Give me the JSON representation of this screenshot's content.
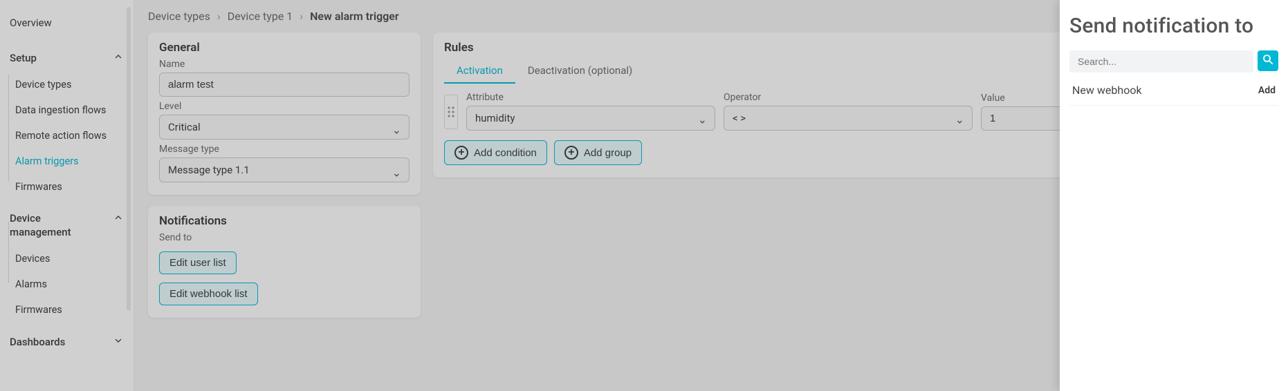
{
  "sidebar": {
    "overview": "Overview",
    "setup": "Setup",
    "device_types": "Device types",
    "data_ingestion": "Data ingestion flows",
    "remote_action": "Remote action flows",
    "alarm_triggers": "Alarm triggers",
    "firmwares": "Firmwares",
    "device_management": "Device management",
    "devices": "Devices",
    "alarms": "Alarms",
    "firmwares2": "Firmwares",
    "dashboards": "Dashboards"
  },
  "breadcrumb": {
    "a": "Device types",
    "b": "Device type 1",
    "c": "New alarm trigger"
  },
  "general": {
    "title": "General",
    "name_label": "Name",
    "name_value": "alarm test",
    "level_label": "Level",
    "level_value": "Critical",
    "msgtype_label": "Message type",
    "msgtype_value": "Message type 1.1"
  },
  "notifications": {
    "title": "Notifications",
    "sendto_label": "Send to",
    "edit_user": "Edit user list",
    "edit_webhook": "Edit webhook list"
  },
  "rules": {
    "title": "Rules",
    "tab_activation": "Activation",
    "tab_deactivation": "Deactivation (optional)",
    "attr_label": "Attribute",
    "attr_value": "humidity",
    "op_label": "Operator",
    "op_value": "< >",
    "val_label": "Value",
    "val_value": "1",
    "add_condition": "Add condition",
    "add_group": "Add group"
  },
  "drawer": {
    "title": "Send notification to",
    "search_placeholder": "Search...",
    "result_label": "New webhook",
    "add_label": "Add"
  }
}
